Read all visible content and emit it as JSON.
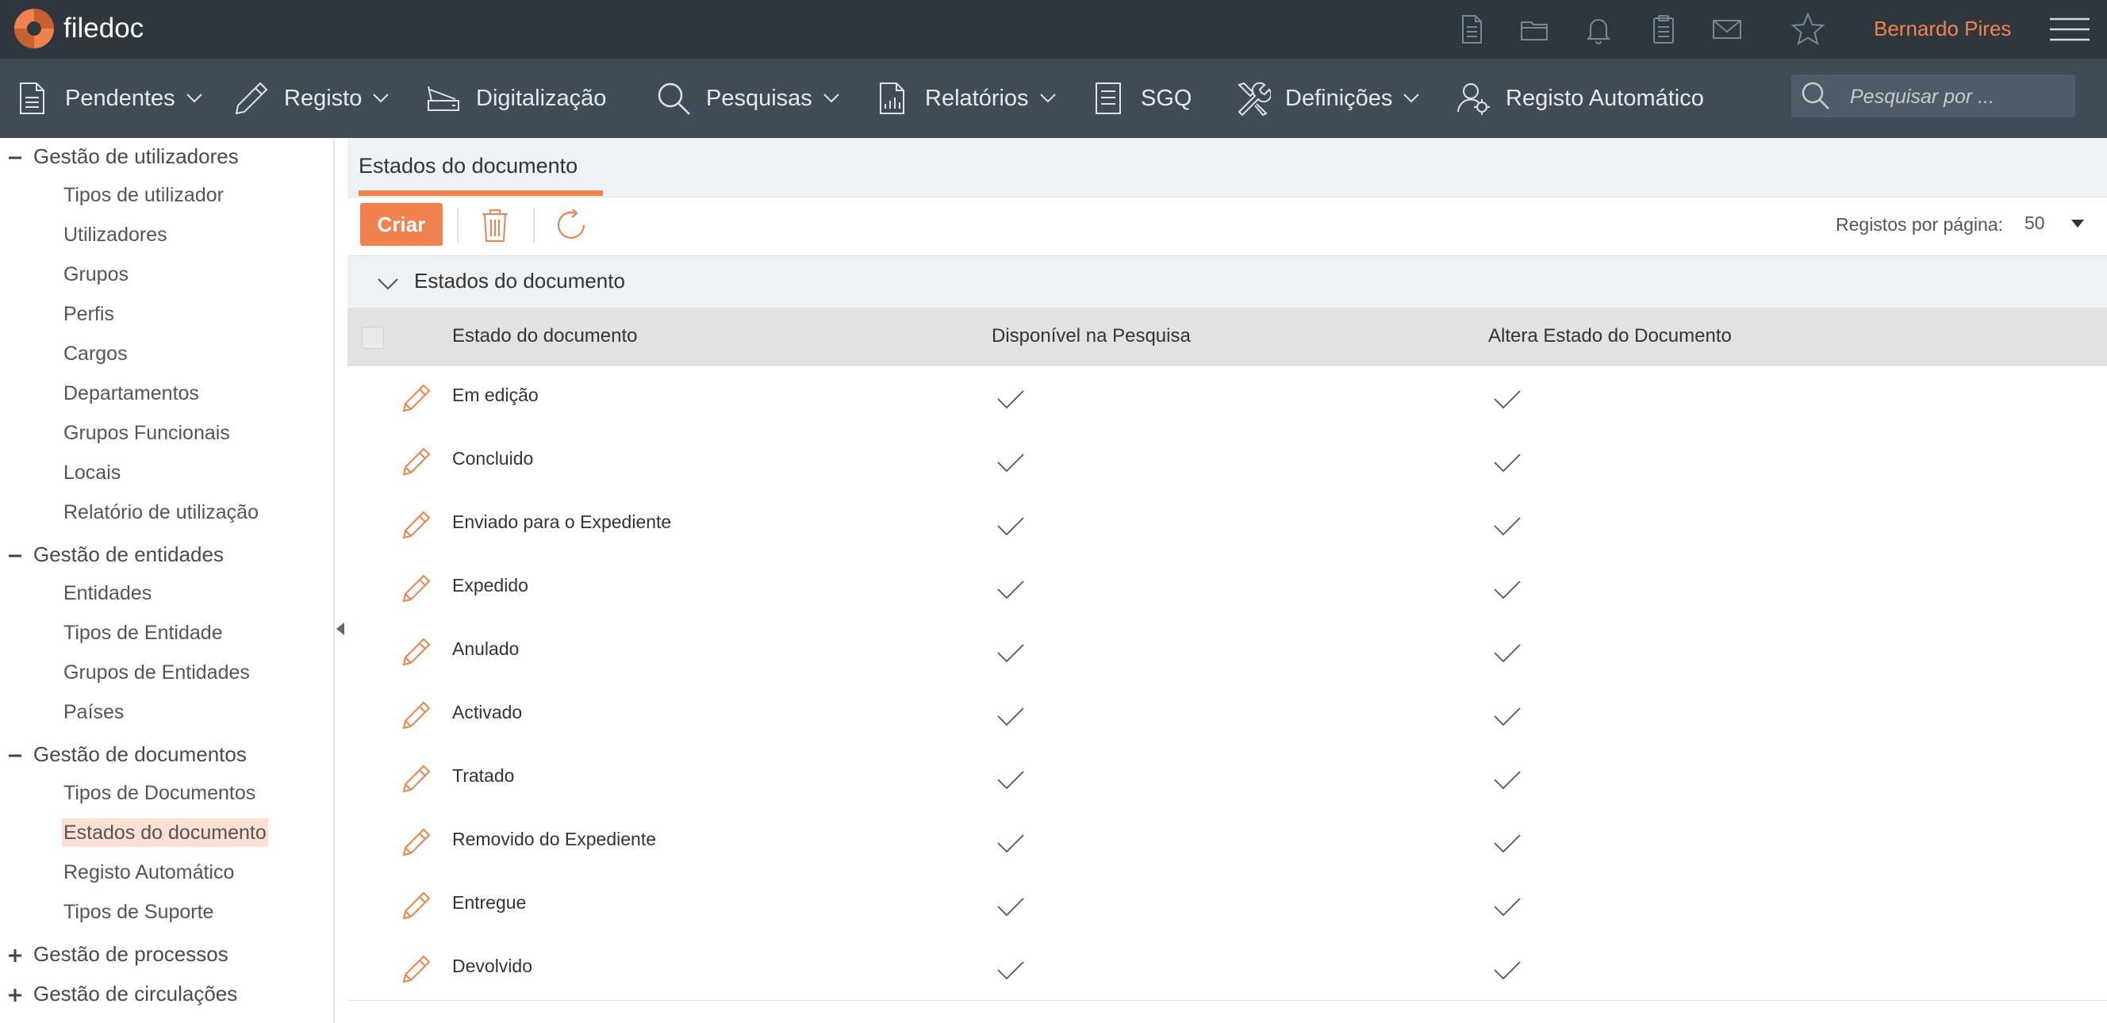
{
  "app": {
    "brand": "filedoc",
    "user_name": "Bernardo Pires",
    "accent_color": "#f0824d"
  },
  "top_icons": [
    "document-icon",
    "folder-icon",
    "bell-icon",
    "clipboard-icon",
    "mail-icon",
    "star-icon",
    "hamburger-menu-icon"
  ],
  "nav": {
    "items": [
      {
        "label": "Pendentes",
        "icon": "document-icon",
        "has_dropdown": true
      },
      {
        "label": "Registo",
        "icon": "pencil-icon",
        "has_dropdown": true
      },
      {
        "label": "Digitalização",
        "icon": "scanner-icon",
        "has_dropdown": false
      },
      {
        "label": "Pesquisas",
        "icon": "search-icon",
        "has_dropdown": true
      },
      {
        "label": "Relatórios",
        "icon": "report-icon",
        "has_dropdown": true
      },
      {
        "label": "SGQ",
        "icon": "list-document-icon",
        "has_dropdown": false
      },
      {
        "label": "Definições",
        "icon": "tools-icon",
        "has_dropdown": true
      },
      {
        "label": "Registo Automático",
        "icon": "user-gear-icon",
        "has_dropdown": false
      }
    ],
    "search_placeholder": "Pesquisar por ..."
  },
  "sidebar": {
    "groups": [
      {
        "label": "Gestão de utilizadores",
        "expanded": true,
        "items": [
          "Tipos de utilizador",
          "Utilizadores",
          "Grupos",
          "Perfis",
          "Cargos",
          "Departamentos",
          "Grupos Funcionais",
          "Locais",
          "Relatório de utilização"
        ]
      },
      {
        "label": "Gestão de entidades",
        "expanded": true,
        "items": [
          "Entidades",
          "Tipos de Entidade",
          "Grupos de Entidades",
          "Países"
        ]
      },
      {
        "label": "Gestão de documentos",
        "expanded": true,
        "items": [
          "Tipos de Documentos",
          "Estados do documento",
          "Registo Automático",
          "Tipos de Suporte"
        ]
      },
      {
        "label": "Gestão de processos",
        "expanded": false,
        "items": []
      },
      {
        "label": "Gestão de circulações",
        "expanded": false,
        "items": []
      }
    ],
    "active_item": "Estados do documento"
  },
  "content": {
    "tab_label": "Estados do documento",
    "toolbar": {
      "create_label": "Criar",
      "per_page_label": "Registos por página:",
      "per_page_value": "50"
    },
    "group_label": "Estados do documento",
    "columns": [
      "Estado do documento",
      "Disponível na Pesquisa",
      "Altera Estado do Documento"
    ],
    "rows": [
      {
        "name": "Em edição",
        "available_in_search": true,
        "changes_state": true
      },
      {
        "name": "Concluido",
        "available_in_search": true,
        "changes_state": true
      },
      {
        "name": "Enviado para o Expediente",
        "available_in_search": true,
        "changes_state": true
      },
      {
        "name": "Expedido",
        "available_in_search": true,
        "changes_state": true
      },
      {
        "name": "Anulado",
        "available_in_search": true,
        "changes_state": true
      },
      {
        "name": "Activado",
        "available_in_search": true,
        "changes_state": true
      },
      {
        "name": "Tratado",
        "available_in_search": true,
        "changes_state": true
      },
      {
        "name": "Removido do Expediente",
        "available_in_search": true,
        "changes_state": true
      },
      {
        "name": "Entregue",
        "available_in_search": true,
        "changes_state": true
      },
      {
        "name": "Devolvido",
        "available_in_search": true,
        "changes_state": true
      }
    ]
  }
}
